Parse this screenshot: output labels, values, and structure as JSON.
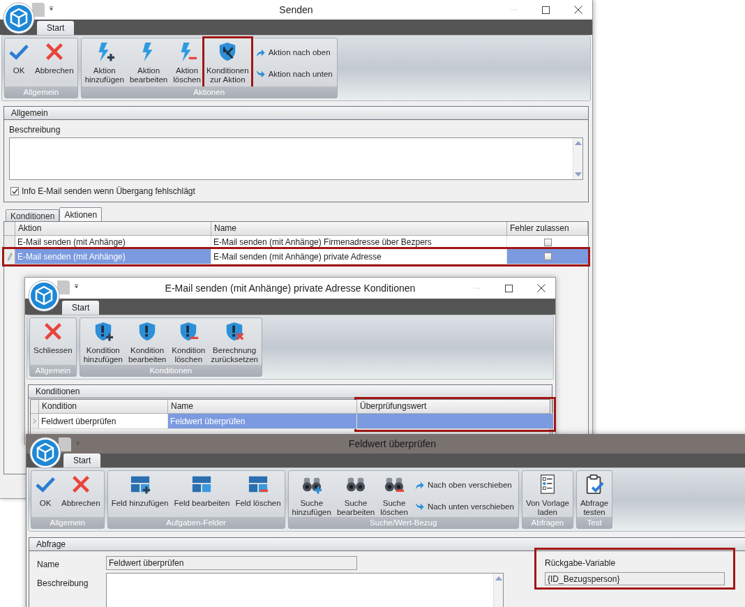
{
  "windows": [
    {
      "title": "Senden",
      "tab": {
        "label": "Start",
        "selected": true
      },
      "ribbon": [
        {
          "label": "Allgemein",
          "buttons": [
            {
              "kind": "large",
              "label": "OK",
              "highlighted": false
            },
            {
              "kind": "large",
              "label": "Abbrechen",
              "highlighted": false
            }
          ]
        },
        {
          "label": "Aktionen",
          "buttons": [
            {
              "kind": "large",
              "label": "Aktion\nhinzufügen",
              "highlighted": false
            },
            {
              "kind": "large",
              "label": "Aktion\nbearbeiten",
              "highlighted": false
            },
            {
              "kind": "large",
              "label": "Aktion\nlöschen",
              "highlighted": false
            },
            {
              "kind": "large",
              "label": "Konditionen\nzur Aktion",
              "highlighted": true
            },
            {
              "kind": "small",
              "label": "Aktion nach oben",
              "highlighted": false
            },
            {
              "kind": "small",
              "label": "Aktion nach unten",
              "highlighted": false
            }
          ]
        }
      ],
      "section": {
        "title": "Allgemein",
        "description_label": "Beschreibung",
        "checkbox": {
          "label": "Info E-Mail senden wenn Übergang fehlschlägt",
          "checked": true
        }
      },
      "tabs": [
        {
          "label": "Konditionen",
          "selected": false
        },
        {
          "label": "Aktionen",
          "selected": true
        }
      ],
      "table": {
        "columns": [
          {
            "label": "Aktion",
            "highlighted": false
          },
          {
            "label": "Name",
            "highlighted": false
          },
          {
            "label": "Fehler zulassen",
            "highlighted": false
          }
        ],
        "rows": [
          {
            "cells": [
              {
                "text": "E-Mail senden (mit Anhänge)"
              },
              {
                "text": "E-Mail senden (mit Anhänge) Firmenadresse über Bezpers"
              }
            ],
            "checkbox": {
              "checked": false
            },
            "selected": false,
            "highlighted": false
          },
          {
            "cells": [
              {
                "text": "E-Mail senden (mit Anhänge)",
                "focused": false
              },
              {
                "text": "E-Mail senden (mit Anhänge) private Adresse",
                "focused": true
              }
            ],
            "checkbox": {
              "checked": false,
              "focused": false
            },
            "selected": true,
            "highlighted": true
          }
        ]
      }
    },
    {
      "title": "E-Mail senden (mit Anhänge) private Adresse Konditionen",
      "tab": {
        "label": "Start",
        "selected": true
      },
      "ribbon": [
        {
          "label": "Allgemein",
          "buttons": [
            {
              "kind": "large",
              "label": "Schliessen",
              "highlighted": false
            }
          ]
        },
        {
          "label": "Konditionen",
          "buttons": [
            {
              "kind": "large",
              "label": "Kondition\nhinzufügen",
              "highlighted": false
            },
            {
              "kind": "large",
              "label": "Kondition\nbearbeiten",
              "highlighted": false
            },
            {
              "kind": "large",
              "label": "Kondition\nlöschen",
              "highlighted": false
            },
            {
              "kind": "large",
              "label": "Berechnung\nzurücksetzen",
              "highlighted": false
            }
          ]
        }
      ],
      "section": {
        "title": "Konditionen"
      },
      "table": {
        "columns": [
          {
            "label": "Kondition",
            "highlighted": false
          },
          {
            "label": "Name",
            "highlighted": false
          },
          {
            "label": "Überprüfungswert",
            "highlighted": true
          }
        ],
        "rows": [
          {
            "cells": [
              {
                "text": "Feldwert überprüfen",
                "focused": true
              },
              {
                "text": "Feldwert überprüfen",
                "focused": false
              }
            ],
            "selected": true,
            "highlighted": false
          }
        ]
      }
    },
    {
      "title": "Feldwert überprüfen",
      "tab": {
        "label": "Start",
        "selected": true
      },
      "ribbon": [
        {
          "label": "Allgemein",
          "buttons": [
            {
              "kind": "large",
              "label": "OK",
              "highlighted": false
            },
            {
              "kind": "large",
              "label": "Abbrechen",
              "highlighted": false
            }
          ]
        },
        {
          "label": "Aufgaben-Felder",
          "buttons": [
            {
              "kind": "large",
              "label": "Feld hinzufügen",
              "highlighted": false
            },
            {
              "kind": "large",
              "label": "Feld bearbeiten",
              "highlighted": false
            },
            {
              "kind": "large",
              "label": "Feld löschen",
              "highlighted": false
            }
          ]
        },
        {
          "label": "Suche/Wert-Bezug",
          "buttons": [
            {
              "kind": "large",
              "label": "Suche\nhinzufügen",
              "highlighted": false
            },
            {
              "kind": "large",
              "label": "Suche\nbearbeiten",
              "highlighted": false
            },
            {
              "kind": "large",
              "label": "Suche\nlöschen",
              "highlighted": false
            },
            {
              "kind": "small",
              "label": "Nach oben verschieben",
              "highlighted": false
            },
            {
              "kind": "small",
              "label": "Nach unten verschieben",
              "highlighted": false
            }
          ]
        },
        {
          "label": "Abfragen",
          "buttons": [
            {
              "kind": "large",
              "label": "Von Vorlage\nladen",
              "highlighted": false
            }
          ]
        },
        {
          "label": "Test",
          "buttons": [
            {
              "kind": "large",
              "label": "Abfrage\ntesten",
              "highlighted": false
            }
          ]
        }
      ],
      "section": {
        "title": "Abfrage",
        "name_label": "Name",
        "name_value": "Feldwert überprüfen",
        "description_label": "Beschreibung",
        "return_variable": {
          "label": "Rückgabe-Variable",
          "value": "{ID_Bezugsperson}",
          "highlighted": true
        }
      }
    }
  ]
}
